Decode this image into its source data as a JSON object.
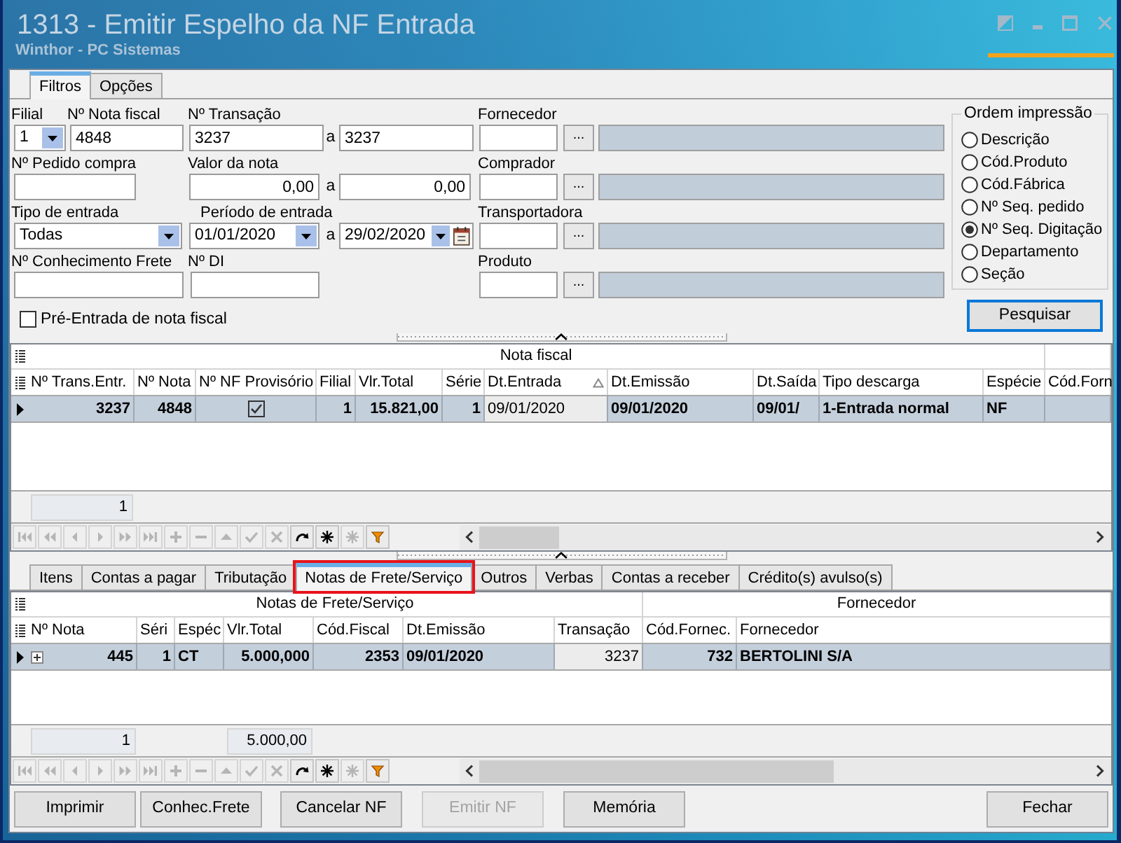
{
  "window": {
    "title": "1313 - Emitir Espelho da NF Entrada",
    "subtitle": "Winthor - PC Sistemas"
  },
  "filter_tabs": [
    {
      "label": "Filtros",
      "selected": true
    },
    {
      "label": "Opções",
      "selected": false
    }
  ],
  "filters": {
    "filial": {
      "label": "Filial",
      "value": "1"
    },
    "nota_fiscal": {
      "label": "Nº Nota fiscal",
      "value": "4848"
    },
    "transacao": {
      "label": "Nº Transação",
      "from": "3237",
      "separator": "a",
      "to": "3237"
    },
    "fornecedor": {
      "label": "Fornecedor",
      "button": "..."
    },
    "pedido_compra": {
      "label": "Nº Pedido compra"
    },
    "valor_nota": {
      "label": "Valor da nota",
      "from": "0,00",
      "separator": "a",
      "to": "0,00"
    },
    "comprador": {
      "label": "Comprador",
      "button": "..."
    },
    "tipo_entrada": {
      "label": "Tipo de entrada",
      "value": "Todas"
    },
    "periodo_entrada": {
      "label": "Período de entrada",
      "from": "01/01/2020",
      "separator": "a",
      "to": "29/02/2020"
    },
    "transportadora": {
      "label": "Transportadora",
      "button": "..."
    },
    "conhecimento_frete": {
      "label": "Nº Conhecimento Frete"
    },
    "di": {
      "label": "Nº DI"
    },
    "produto": {
      "label": "Produto",
      "button": "..."
    },
    "pre_entrada": {
      "label": "Pré-Entrada de nota fiscal",
      "checked": false
    }
  },
  "print_order": {
    "title": "Ordem impressão",
    "options": [
      {
        "label": "Descrição",
        "selected": false
      },
      {
        "label": "Cód.Produto",
        "selected": false
      },
      {
        "label": "Cód.Fábrica",
        "selected": false
      },
      {
        "label": "Nº Seq. pedido",
        "selected": false
      },
      {
        "label": "Nº Seq. Digitação",
        "selected": true
      },
      {
        "label": "Departamento",
        "selected": false
      },
      {
        "label": "Seção",
        "selected": false
      }
    ]
  },
  "search_button": {
    "label": "Pesquisar",
    "focused": true
  },
  "invoice_grid": {
    "bands": [
      {
        "label": "Nota fiscal",
        "columns": [
          {
            "label": "Nº Trans.Entr.",
            "kind": "number",
            "sorted": false,
            "summary": "1"
          },
          {
            "label": "Nº Nota",
            "kind": "number",
            "sorted": false
          },
          {
            "label": "Nº NF Provisório",
            "kind": "check",
            "sorted": false
          },
          {
            "label": "Filial",
            "kind": "number",
            "sorted": false
          },
          {
            "label": "Vlr.Total",
            "kind": "number",
            "sorted": false
          },
          {
            "label": "Série",
            "kind": "number",
            "sorted": false
          },
          {
            "label": "Dt.Entrada",
            "kind": "text",
            "sorted": true
          },
          {
            "label": "Dt.Emissão",
            "kind": "text",
            "sorted": false
          },
          {
            "label": "Dt.Saída",
            "kind": "text",
            "sorted": false
          },
          {
            "label": "Tipo descarga",
            "kind": "text",
            "sorted": false
          },
          {
            "label": "Espécie",
            "kind": "text",
            "sorted": false
          }
        ]
      },
      {
        "columns": [
          {
            "label": "Cód.Forn",
            "sorted": false
          }
        ]
      }
    ],
    "rows": [
      {
        "selected": true,
        "cells": [
          {
            "text": "3237",
            "focused": false
          },
          {
            "text": "4848",
            "focused": false
          },
          {
            "checked": true,
            "focused": false
          },
          {
            "text": "1",
            "focused": false
          },
          {
            "text": "15.821,00",
            "focused": false
          },
          {
            "text": "1",
            "focused": false
          },
          {
            "text": "09/01/2020",
            "focused": true
          },
          {
            "text": "09/01/2020",
            "focused": false
          },
          {
            "text": "09/01/",
            "focused": false
          },
          {
            "text": "1-Entrada normal",
            "focused": false
          },
          {
            "text": "NF",
            "focused": false
          }
        ]
      }
    ],
    "navigator": [
      {
        "kind": "first",
        "disabled": true
      },
      {
        "kind": "prior_page",
        "disabled": true
      },
      {
        "kind": "prior",
        "disabled": true
      },
      {
        "kind": "next",
        "disabled": true
      },
      {
        "kind": "next_page",
        "disabled": true
      },
      {
        "kind": "last",
        "disabled": true
      },
      {
        "kind": "insert",
        "disabled": true
      },
      {
        "kind": "delete",
        "disabled": true
      },
      {
        "kind": "edit",
        "disabled": true
      },
      {
        "kind": "post",
        "disabled": true
      },
      {
        "kind": "cancel",
        "disabled": true
      },
      {
        "kind": "refresh",
        "disabled": false
      },
      {
        "kind": "set_bookmark",
        "disabled": false
      },
      {
        "kind": "goto_bookmark",
        "disabled": true
      },
      {
        "kind": "filter",
        "disabled": false
      }
    ]
  },
  "detail_tabs": [
    {
      "label": "Itens",
      "selected": false,
      "highlighted": false
    },
    {
      "label": "Contas a pagar",
      "selected": false,
      "highlighted": false
    },
    {
      "label": "Tributação",
      "selected": false,
      "highlighted": false
    },
    {
      "label": "Notas de Frete/Serviço",
      "selected": true,
      "highlighted": true
    },
    {
      "label": "Outros",
      "selected": false,
      "highlighted": false
    },
    {
      "label": "Verbas",
      "selected": false,
      "highlighted": false
    },
    {
      "label": "Contas a receber",
      "selected": false,
      "highlighted": false
    },
    {
      "label": "Crédito(s) avulso(s)",
      "selected": false,
      "highlighted": false
    }
  ],
  "freight_grid": {
    "bands": [
      {
        "label": "Notas de Frete/Serviço",
        "columns": [
          {
            "label": "Nº Nota",
            "kind": "number",
            "sorted": false,
            "summary": "1"
          },
          {
            "label": "Séri",
            "kind": "number",
            "sorted": false
          },
          {
            "label": "Espéc",
            "kind": "text",
            "sorted": false
          },
          {
            "label": "Vlr.Total",
            "kind": "number",
            "sorted": false,
            "summary": "5.000,00"
          },
          {
            "label": "Cód.Fiscal",
            "kind": "number",
            "sorted": false
          },
          {
            "label": "Dt.Emissão",
            "kind": "text",
            "sorted": false
          },
          {
            "label": "Transação",
            "kind": "number",
            "sorted": false
          }
        ]
      },
      {
        "label": "Fornecedor",
        "columns": [
          {
            "label": "Cód.Fornec.",
            "kind": "number",
            "sorted": false
          },
          {
            "label": "Fornecedor",
            "kind": "text",
            "sorted": false
          }
        ]
      }
    ],
    "rows": [
      {
        "selected": true,
        "expanded": false,
        "cells": [
          {
            "text": "445",
            "focused": false
          },
          {
            "text": "1",
            "focused": false
          },
          {
            "text": "CT",
            "focused": false
          },
          {
            "text": "5.000,000",
            "focused": false
          },
          {
            "text": "2353",
            "focused": false
          },
          {
            "text": "09/01/2020",
            "focused": false
          },
          {
            "text": "3237",
            "focused": true
          },
          {
            "text": "732",
            "focused": false
          },
          {
            "text": "BERTOLINI S/A",
            "focused": false
          }
        ]
      }
    ],
    "navigator": [
      {
        "kind": "first",
        "disabled": true
      },
      {
        "kind": "prior_page",
        "disabled": true
      },
      {
        "kind": "prior",
        "disabled": true
      },
      {
        "kind": "next",
        "disabled": true
      },
      {
        "kind": "next_page",
        "disabled": true
      },
      {
        "kind": "last",
        "disabled": true
      },
      {
        "kind": "insert",
        "disabled": true
      },
      {
        "kind": "delete",
        "disabled": true
      },
      {
        "kind": "edit",
        "disabled": true
      },
      {
        "kind": "post",
        "disabled": true
      },
      {
        "kind": "cancel",
        "disabled": true
      },
      {
        "kind": "refresh",
        "disabled": false
      },
      {
        "kind": "set_bookmark",
        "disabled": false
      },
      {
        "kind": "goto_bookmark",
        "disabled": true
      },
      {
        "kind": "filter",
        "disabled": false
      }
    ]
  },
  "actions": [
    {
      "label": "Imprimir",
      "disabled": false
    },
    {
      "label": "Conhec.Frete",
      "disabled": false
    },
    {
      "label": "Cancelar NF",
      "disabled": false
    },
    {
      "label": "Emitir NF",
      "disabled": true
    },
    {
      "label": "Memória",
      "disabled": false
    }
  ],
  "close_button": {
    "label": "Fechar"
  }
}
